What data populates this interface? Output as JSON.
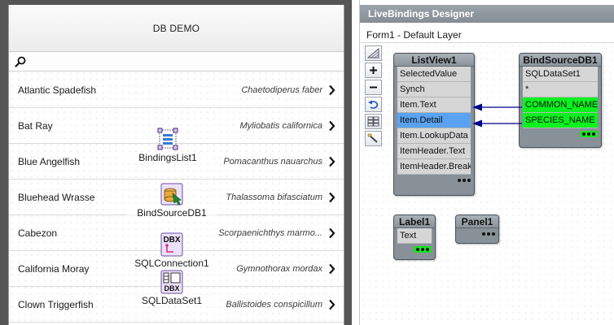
{
  "form": {
    "title": "DB DEMO",
    "search_placeholder": "",
    "items": [
      {
        "text": "Atlantic Spadefish",
        "detail": "Chaetodiperus faber"
      },
      {
        "text": "Bat Ray",
        "detail": "Myliobatis californica"
      },
      {
        "text": "Blue Angelfish",
        "detail": "Pomacanthus nauarchus"
      },
      {
        "text": "Bluehead Wrasse",
        "detail": "Thalassoma bifasciatum"
      },
      {
        "text": "Cabezon",
        "detail": "Scorpaenichthys marmo..."
      },
      {
        "text": "California Moray",
        "detail": "Gymnothorax mordax"
      },
      {
        "text": "Clown Triggerfish",
        "detail": "Ballistoides conspicillum"
      }
    ],
    "components": [
      {
        "name": "BindingsList1",
        "icon": "bindings-list-icon"
      },
      {
        "name": "BindSourceDB1",
        "icon": "bind-source-icon"
      },
      {
        "name": "SQLConnection1",
        "icon": "dbx-connection-icon",
        "icon_text": "DBX"
      },
      {
        "name": "SQLDataSet1",
        "icon": "dbx-dataset-icon",
        "icon_text": "DBX"
      }
    ]
  },
  "designer": {
    "title": "LiveBindings Designer",
    "layer": "Form1   - Default Layer",
    "tools": [
      "grid-icon",
      "zoom-in-icon",
      "zoom-out-icon",
      "undo-layout-icon",
      "layers-icon",
      "wizard-icon"
    ],
    "nodes": {
      "listview": {
        "title": "ListView1",
        "rows": [
          "SelectedValue",
          "Synch",
          "Item.Text",
          "Item.Detail",
          "Item.LookupData",
          "ItemHeader.Text",
          "ItemHeader.Break"
        ]
      },
      "bindsource": {
        "title": "BindSourceDB1",
        "rows": [
          "SQLDataSet1",
          "*",
          "COMMON_NAME",
          "SPECIES_NAME"
        ]
      },
      "label": {
        "title": "Label1",
        "rows": [
          "Text"
        ]
      },
      "panel": {
        "title": "Panel1",
        "rows": []
      }
    },
    "links": [
      {
        "from": "COMMON_NAME",
        "to": "Item.Text"
      },
      {
        "from": "SPECIES_NAME",
        "to": "Item.Detail"
      }
    ],
    "colors": {
      "selected_blue": "#5aa3f2",
      "bound_green": "#0bf21e",
      "link_line": "#00008b",
      "header": "#8b949b"
    }
  }
}
